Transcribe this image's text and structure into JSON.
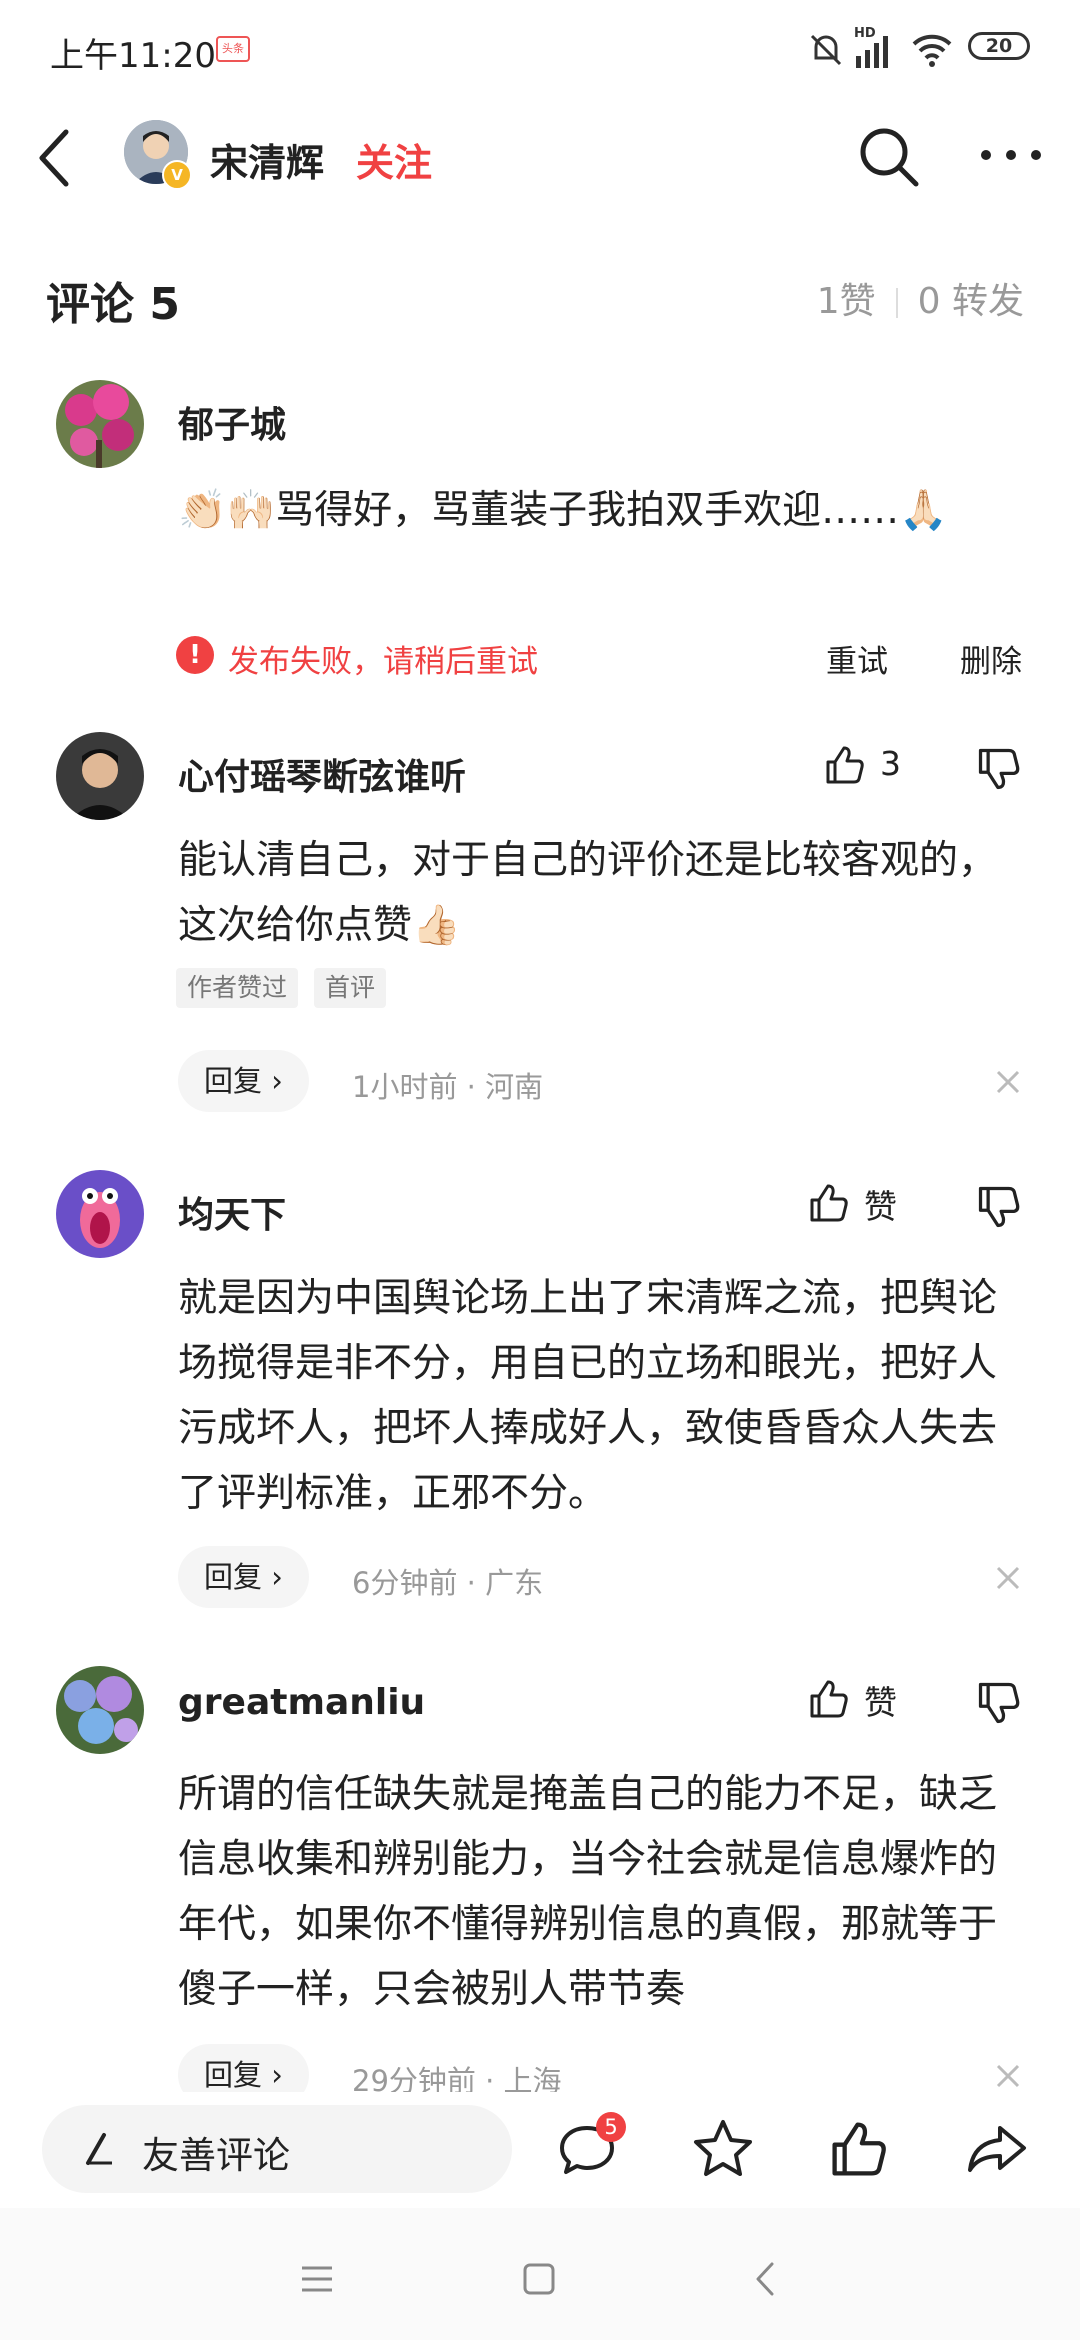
{
  "status_bar": {
    "time": "上午11:20",
    "app_badge": "头条",
    "battery": "20",
    "network": "HD"
  },
  "header": {
    "author_name": "宋清辉",
    "follow_label": "关注",
    "icons": {
      "back": "back-arrow-icon",
      "search": "search-icon",
      "more": "more-icon"
    }
  },
  "comments_header": {
    "title": "评论 5",
    "likes": "1赞",
    "shares": "0 转发"
  },
  "comments": [
    {
      "name": "郁子城",
      "text": "👏🏻🙌🏻骂得好，骂董装子我拍双手欢迎……🙏🏻",
      "failed_text": "发布失败，请稍后重试",
      "retry": "重试",
      "delete": "删除"
    },
    {
      "name": "心付瑶琴断弦谁听",
      "likes": "3",
      "text": "能认清自己，对于自己的评价还是比较客观的，这次给你点赞👍🏻",
      "tags": [
        "作者赞过",
        "首评"
      ],
      "reply": "回复 ›",
      "meta": "1小时前 · 河南"
    },
    {
      "name": "均天下",
      "likes": "赞",
      "text": "就是因为中国舆论场上出了宋清辉之流，把舆论场搅得是非不分，用自已的立场和眼光，把好人污成坏人，把坏人捧成好人，致使昏昏众人失去了评判标准，正邪不分。",
      "reply": "回复 ›",
      "meta": "6分钟前 · 广东"
    },
    {
      "name": "greatmanliu",
      "likes": "赞",
      "text": "所谓的信任缺失就是掩盖自己的能力不足，缺乏信息收集和辨别能力，当今社会就是信息爆炸的年代，如果你不懂得辨别信息的真假，那就等于傻子一样，只会被别人带节奏",
      "reply": "回复 ›",
      "meta": "29分钟前 · 上海"
    }
  ],
  "bottom_bar": {
    "input_placeholder": "友善评论",
    "comment_count": "5"
  },
  "colors": {
    "accent": "#f04142",
    "muted": "#999999"
  }
}
